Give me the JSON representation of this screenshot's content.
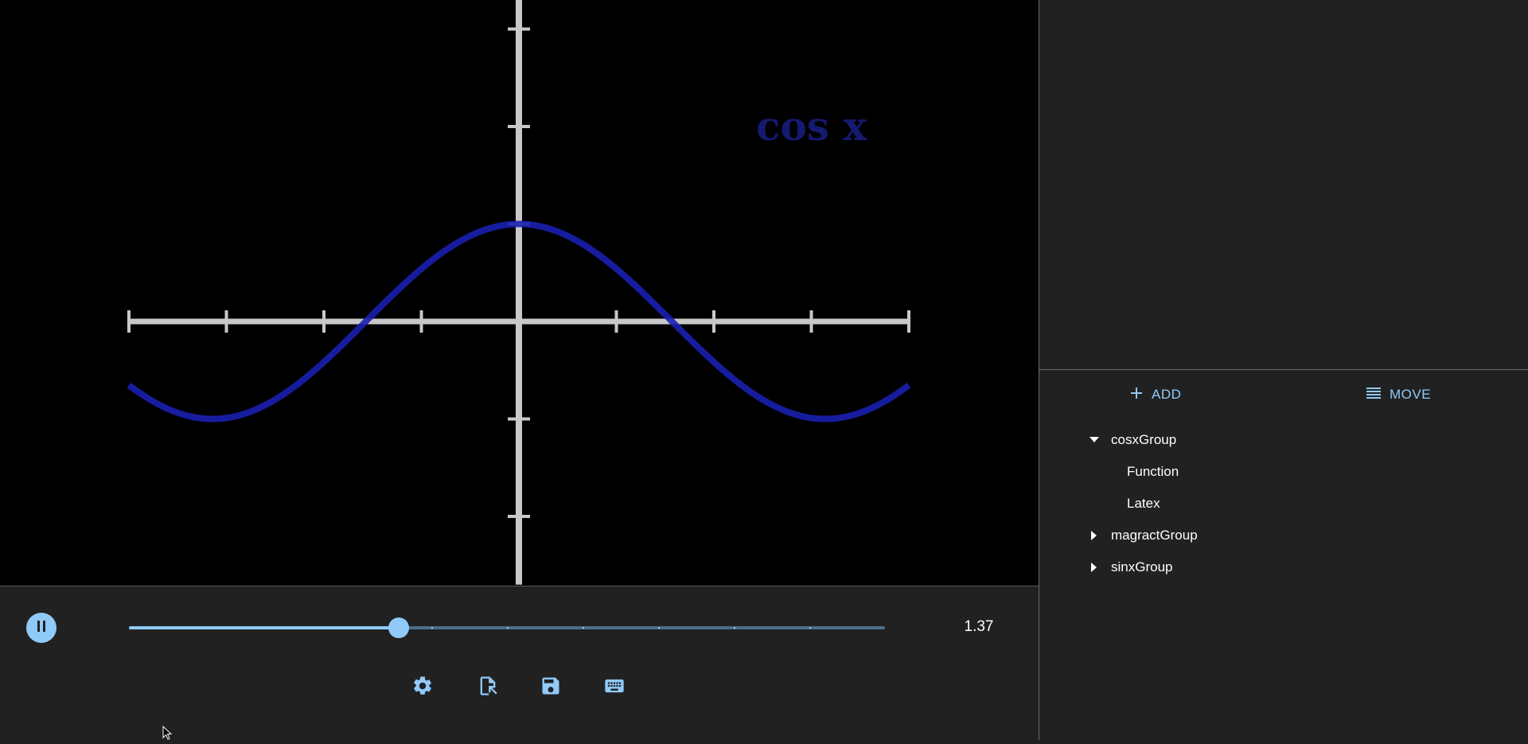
{
  "canvas": {
    "latex_label": "cos x",
    "colors": {
      "background": "#000000",
      "axes": "#c8c8c8",
      "curve": "#1a1fb0",
      "label": "#141a70"
    },
    "axes": {
      "x_ticks": [
        -4,
        -3,
        -2,
        -1,
        1,
        2,
        3,
        4
      ],
      "y_ticks": [
        -2,
        -1,
        1,
        2,
        3
      ],
      "x_range": [
        -4,
        4
      ],
      "y_range": [
        -2.7,
        3.3
      ]
    },
    "function": "cos"
  },
  "toolbar": {
    "add_label": "ADD",
    "add_icon": "plus-icon",
    "move_label": "MOVE",
    "move_icon": "list-icon"
  },
  "tree": [
    {
      "label": "cosxGroup",
      "expanded": true,
      "children": [
        "Function",
        "Latex"
      ]
    },
    {
      "label": "magractGroup",
      "expanded": false
    },
    {
      "label": "sinxGroup",
      "expanded": false
    }
  ],
  "playback": {
    "state": "playing",
    "time_display": "1.37",
    "progress": 0.357,
    "slider_ticks": 10
  },
  "actions": {
    "settings_icon": "gear-icon",
    "import_icon": "file-import-icon",
    "save_icon": "save-icon",
    "keyboard_icon": "keyboard-icon"
  },
  "accent_color": "#90caf9"
}
